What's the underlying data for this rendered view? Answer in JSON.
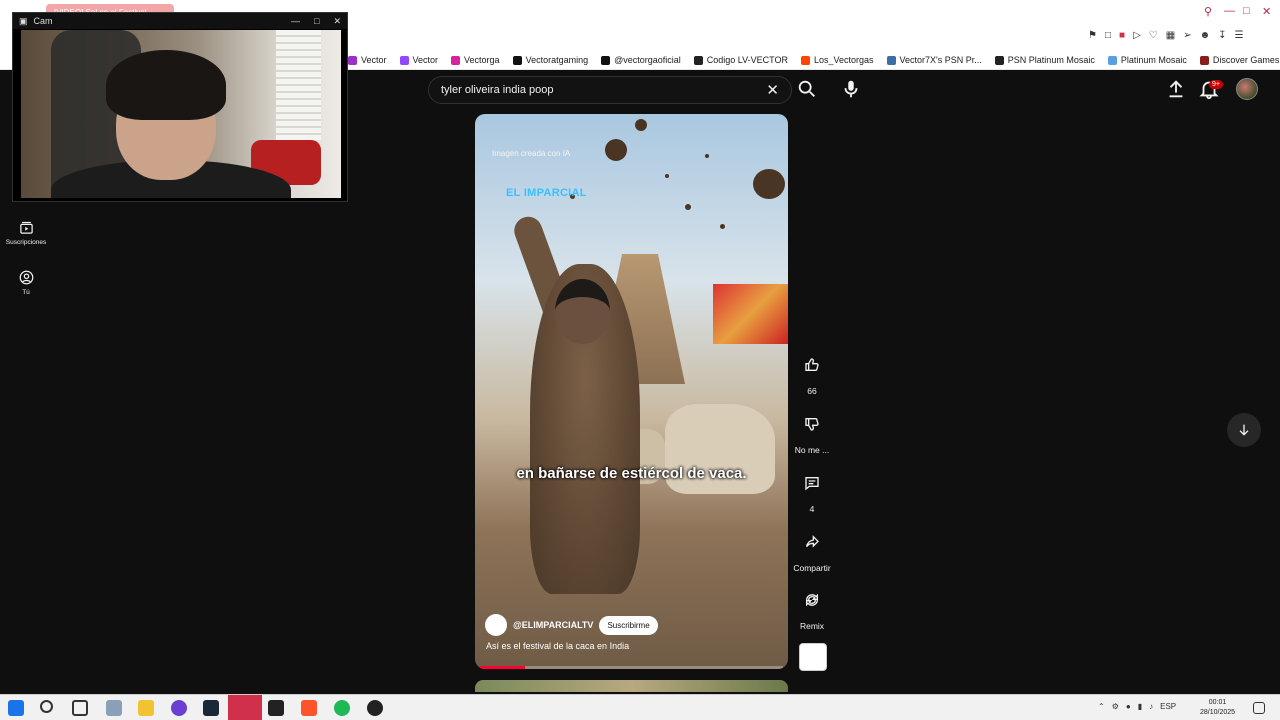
{
  "browser": {
    "active_tab_label": "[VIDEO] Sol en el Festival",
    "bookmarks": [
      {
        "label": "Vector",
        "icon": "vector-icon",
        "color": "#9b2fc7"
      },
      {
        "label": "Vector",
        "icon": "twitch-icon",
        "color": "#9146ff"
      },
      {
        "label": "Vectorga",
        "icon": "instagram-icon",
        "color": "#d6249f"
      },
      {
        "label": "Vectoratgaming",
        "icon": "x-icon",
        "color": "#111111"
      },
      {
        "label": "@vectorgaoficial",
        "icon": "tiktok-icon",
        "color": "#111111"
      },
      {
        "label": "Codigo LV-VECTOR",
        "icon": "code-icon",
        "color": "#222222"
      },
      {
        "label": "Los_Vectorgas",
        "icon": "reddit-icon",
        "color": "#ff4500"
      },
      {
        "label": "Vector7X's PSN Pr...",
        "icon": "psn-icon",
        "color": "#3b6ea5"
      },
      {
        "label": "PSN Platinum Mosaic",
        "icon": "psn-icon",
        "color": "#222222"
      },
      {
        "label": "Platinum Mosaic",
        "icon": "diamond-icon",
        "color": "#5aa0e0"
      },
      {
        "label": "Discover Games -...",
        "icon": "games-icon",
        "color": "#8b1c1c"
      }
    ]
  },
  "cam": {
    "title": "Cam"
  },
  "header": {
    "search_query": "tyler oliveira india poop",
    "notification_count": "9+"
  },
  "sidebar": {
    "items": [
      {
        "label": "Suscripciones",
        "icon": "subscriptions-icon"
      },
      {
        "label": "Tú",
        "icon": "account-icon"
      }
    ]
  },
  "video": {
    "ai_label": "Imagen creada con IA",
    "brand_text": "EL IMPARCIAL",
    "caption": "en bañarse de estiércol de vaca.",
    "channel": "@ELIMPARCIALTV",
    "subscribe_label": "Suscribirme",
    "title": "Así es el festival de la caca en India",
    "progress_fraction": 0.15
  },
  "actions": {
    "like_count": "66",
    "dislike_label": "No me ...",
    "comment_count": "4",
    "share_label": "Compartir",
    "remix_label": "Remix"
  },
  "taskbar": {
    "language": "ESP",
    "time": "00:01",
    "date": "28/10/2025"
  }
}
